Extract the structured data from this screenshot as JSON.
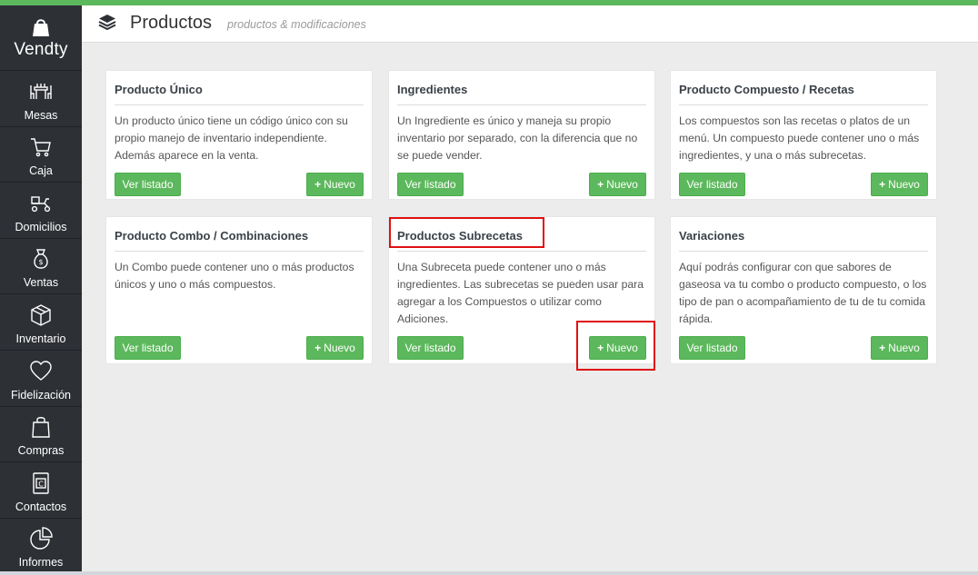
{
  "brand": {
    "name": "Vendty",
    "accent_color": "#5cb85c",
    "highlight_color": "#e01010"
  },
  "sidebar": {
    "items": [
      {
        "label": "Mesas",
        "icon": "dining-table-icon"
      },
      {
        "label": "Caja",
        "icon": "shopping-cart-icon"
      },
      {
        "label": "Domicilios",
        "icon": "delivery-scooter-icon"
      },
      {
        "label": "Ventas",
        "icon": "money-bag-icon"
      },
      {
        "label": "Inventario",
        "icon": "box-icon"
      },
      {
        "label": "Fidelización",
        "icon": "heart-icon"
      },
      {
        "label": "Compras",
        "icon": "shopping-bag-icon"
      },
      {
        "label": "Contactos",
        "icon": "contacts-book-icon"
      },
      {
        "label": "Informes",
        "icon": "pie-chart-icon"
      }
    ]
  },
  "header": {
    "icon": "layers-icon",
    "title": "Productos",
    "subtitle": "productos & modificaciones"
  },
  "cards": [
    {
      "title": "Producto Único",
      "description": "Un producto único tiene un código único con su propio manejo de inventario independiente. Además aparece en la venta.",
      "list_label": "Ver listado",
      "new_label": "Nuevo"
    },
    {
      "title": "Ingredientes",
      "description": "Un Ingrediente es único y maneja su propio inventario por separado, con la diferencia que no se puede vender.",
      "list_label": "Ver listado",
      "new_label": "Nuevo"
    },
    {
      "title": "Producto Compuesto / Recetas",
      "description": "Los compuestos son las recetas o platos de un menú. Un compuesto puede contener uno o más ingredientes, y una o más subrecetas.",
      "list_label": "Ver listado",
      "new_label": "Nuevo"
    },
    {
      "title": "Producto Combo / Combinaciones",
      "description": "Un Combo puede contener uno o más productos únicos y uno o más compuestos.",
      "list_label": "Ver listado",
      "new_label": "Nuevo"
    },
    {
      "title": "Productos Subrecetas",
      "description": "Una Subreceta puede contener uno o más ingredientes. Las subrecetas se pueden usar para agregar a los Compuestos o utilizar como Adiciones.",
      "list_label": "Ver listado",
      "new_label": "Nuevo"
    },
    {
      "title": "Variaciones",
      "description": "Aquí podrás configurar con que sabores de gaseosa va tu combo o producto compuesto, o los tipo de pan o acompañamiento de tu de tu comida rápida.",
      "list_label": "Ver listado",
      "new_label": "Nuevo"
    }
  ]
}
